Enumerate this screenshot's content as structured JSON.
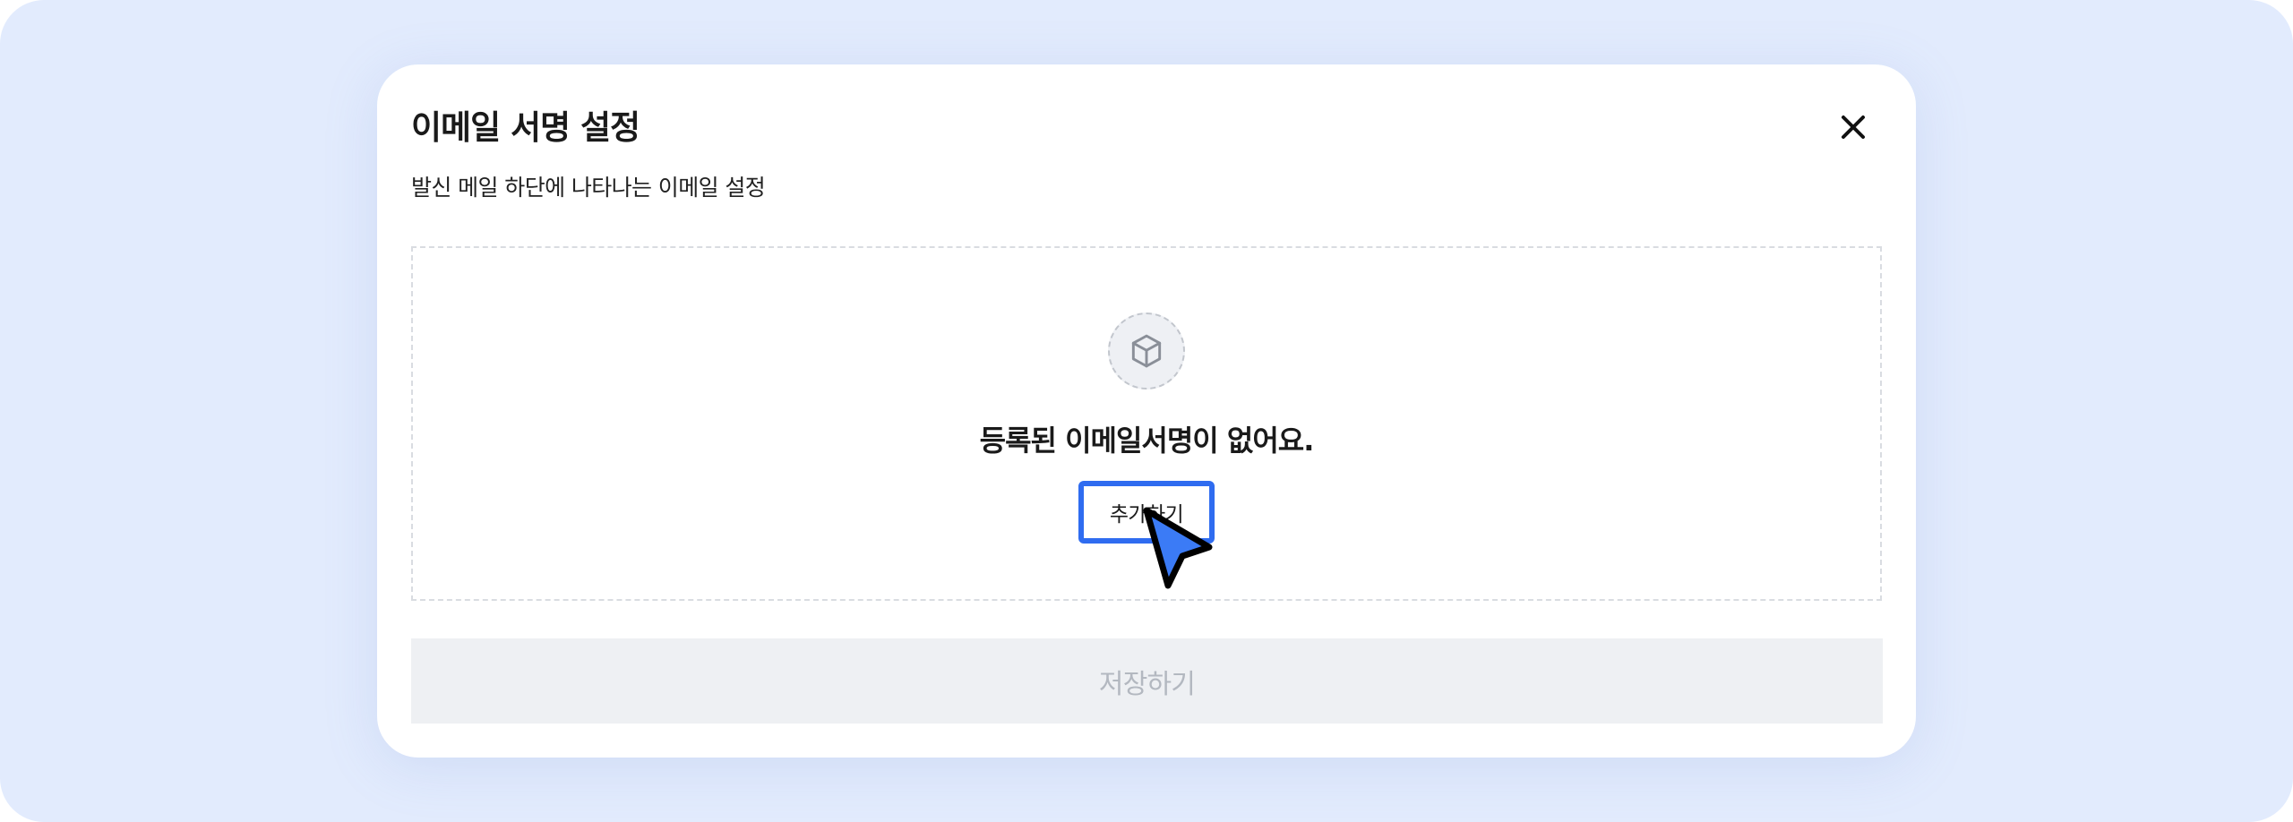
{
  "modal": {
    "title": "이메일 서명 설정",
    "subtitle": "발신 메일 하단에 나타나는 이메일 설정",
    "close_icon": "close-icon"
  },
  "empty_state": {
    "icon": "box-icon",
    "message": "등록된 이메일서명이 없어요.",
    "add_label": "추가하기"
  },
  "footer": {
    "save_label": "저장하기",
    "save_enabled": false
  },
  "cursor": {
    "icon": "mouse-pointer-icon"
  },
  "colors": {
    "background": "#e2ebfd",
    "accent": "#2f6cf0",
    "disabled_bg": "#eef0f3",
    "disabled_text": "#b3b8c0"
  }
}
